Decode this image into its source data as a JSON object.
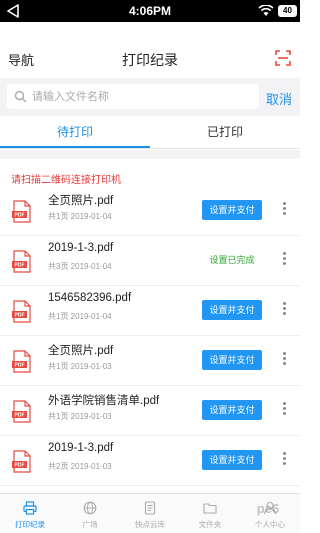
{
  "status_bar": {
    "time": "4:06PM",
    "battery": "40"
  },
  "header": {
    "nav_label": "导航",
    "title": "打印纪录",
    "scan_icon": "scan-icon"
  },
  "search": {
    "placeholder": "请输入文件名称",
    "cancel_label": "取消"
  },
  "tabs": [
    {
      "label": "待打印",
      "active": true
    },
    {
      "label": "已打印",
      "active": false
    }
  ],
  "hint": "请扫描二维码连接打印机",
  "records": [
    {
      "name": "全页照片.pdf",
      "meta": "共1页 2019-01-04",
      "action": "设置并支付",
      "status": "pending"
    },
    {
      "name": "2019-1-3.pdf",
      "meta": "共3页 2019-01-04",
      "action": "设置已完成",
      "status": "done"
    },
    {
      "name": "1546582396.pdf",
      "meta": "共1页 2019-01-04",
      "action": "设置并支付",
      "status": "pending"
    },
    {
      "name": "全页照片.pdf",
      "meta": "共1页 2019-01-03",
      "action": "设置并支付",
      "status": "pending"
    },
    {
      "name": "外语学院销售清单.pdf",
      "meta": "共1页 2019-01-03",
      "action": "设置并支付",
      "status": "pending"
    },
    {
      "name": "2019-1-3.pdf",
      "meta": "共2页 2019-01-03",
      "action": "设置并支付",
      "status": "pending"
    }
  ],
  "tabbar": [
    {
      "label": "打印纪录",
      "icon": "printer-icon",
      "active": true
    },
    {
      "label": "广场",
      "icon": "globe-icon",
      "active": false
    },
    {
      "label": "快点云库",
      "icon": "document-icon",
      "active": false
    },
    {
      "label": "文件夹",
      "icon": "folder-icon",
      "active": false
    },
    {
      "label": "个人中心",
      "icon": "user-icon",
      "active": false
    }
  ],
  "watermark": "pc6",
  "colors": {
    "accent": "#1e90e8",
    "button": "#2196f3",
    "hint": "#e53935",
    "done": "#2ea52e",
    "pdf": "#e8493f"
  }
}
